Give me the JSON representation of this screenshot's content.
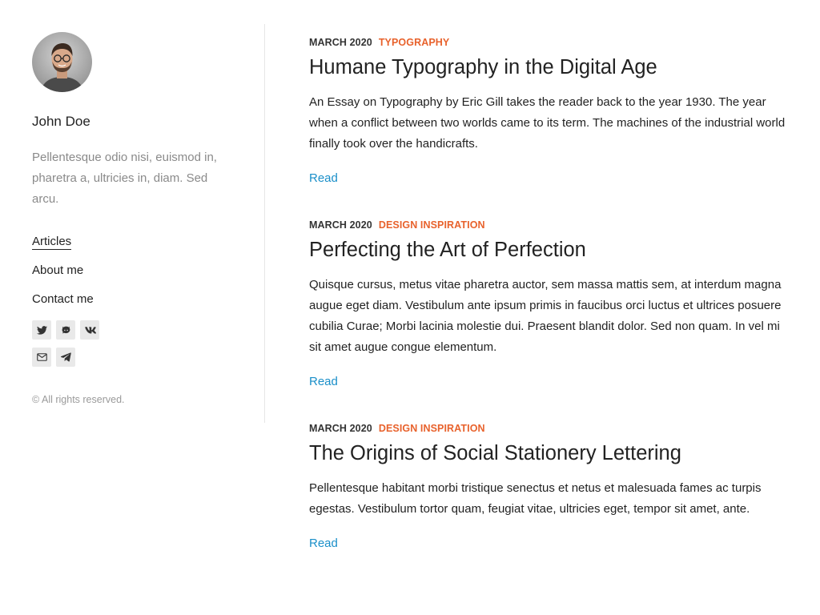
{
  "sidebar": {
    "author_name": "John Doe",
    "author_bio": "Pellentesque odio nisi, euismod in, pharetra a, ultricies in, diam. Sed arcu.",
    "nav": [
      {
        "label": "Articles",
        "active": true
      },
      {
        "label": "About me",
        "active": false
      },
      {
        "label": "Contact me",
        "active": false
      }
    ],
    "social_icons": [
      "twitter-icon",
      "github-icon",
      "vk-icon",
      "email-icon",
      "telegram-icon"
    ],
    "copyright": "© All rights reserved."
  },
  "posts": [
    {
      "date": "MARCH 2020",
      "category": "TYPOGRAPHY",
      "title": "Humane Typography in the Digital Age",
      "excerpt": "An Essay on Typography by Eric Gill takes the reader back to the year 1930. The year when a conflict between two worlds came to its term. The machines of the industrial world finally took over the handicrafts.",
      "read_label": "Read"
    },
    {
      "date": "MARCH 2020",
      "category": "DESIGN INSPIRATION",
      "title": "Perfecting the Art of Perfection",
      "excerpt": "Quisque cursus, metus vitae pharetra auctor, sem massa mattis sem, at interdum magna augue eget diam. Vestibulum ante ipsum primis in faucibus orci luctus et ultrices posuere cubilia Curae; Morbi lacinia molestie dui. Praesent blandit dolor. Sed non quam. In vel mi sit amet augue congue elementum.",
      "read_label": "Read"
    },
    {
      "date": "MARCH 2020",
      "category": "DESIGN INSPIRATION",
      "title": "The Origins of Social Stationery Lettering",
      "excerpt": "Pellentesque habitant morbi tristique senectus et netus et malesuada fames ac turpis egestas. Vestibulum tortor quam, feugiat vitae, ultricies eget, tempor sit amet, ante.",
      "read_label": "Read"
    }
  ],
  "colors": {
    "accent_category": "#e8622c",
    "link": "#1a8fc9",
    "muted_text": "#8a8a8a"
  }
}
